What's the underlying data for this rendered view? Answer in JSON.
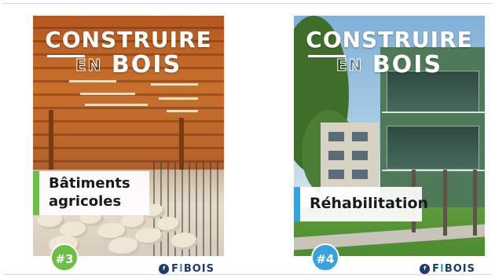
{
  "colors": {
    "accent_green": "#6cbe45",
    "accent_blue": "#36a3e1",
    "brand_navy": "#1d3b6a"
  },
  "covers": [
    {
      "title_line1": "CONSTRUIRE",
      "title_en": "EN",
      "title_bois": "BOIS",
      "topic_line1": "Bâtiments",
      "topic_line2": "agricoles",
      "issue": "#3",
      "brand_icon": "fibois-logo-icon",
      "brand_name_a": "F",
      "brand_name_i": "I",
      "brand_name_b": "BOIS"
    },
    {
      "title_line1": "CONSTRUIRE",
      "title_en": "EN",
      "title_bois": "BOIS",
      "topic_line1": "Réhabilitation",
      "issue": "#4",
      "brand_icon": "fibois-logo-icon",
      "brand_name_a": "F",
      "brand_name_i": "I",
      "brand_name_b": "BOIS"
    }
  ]
}
